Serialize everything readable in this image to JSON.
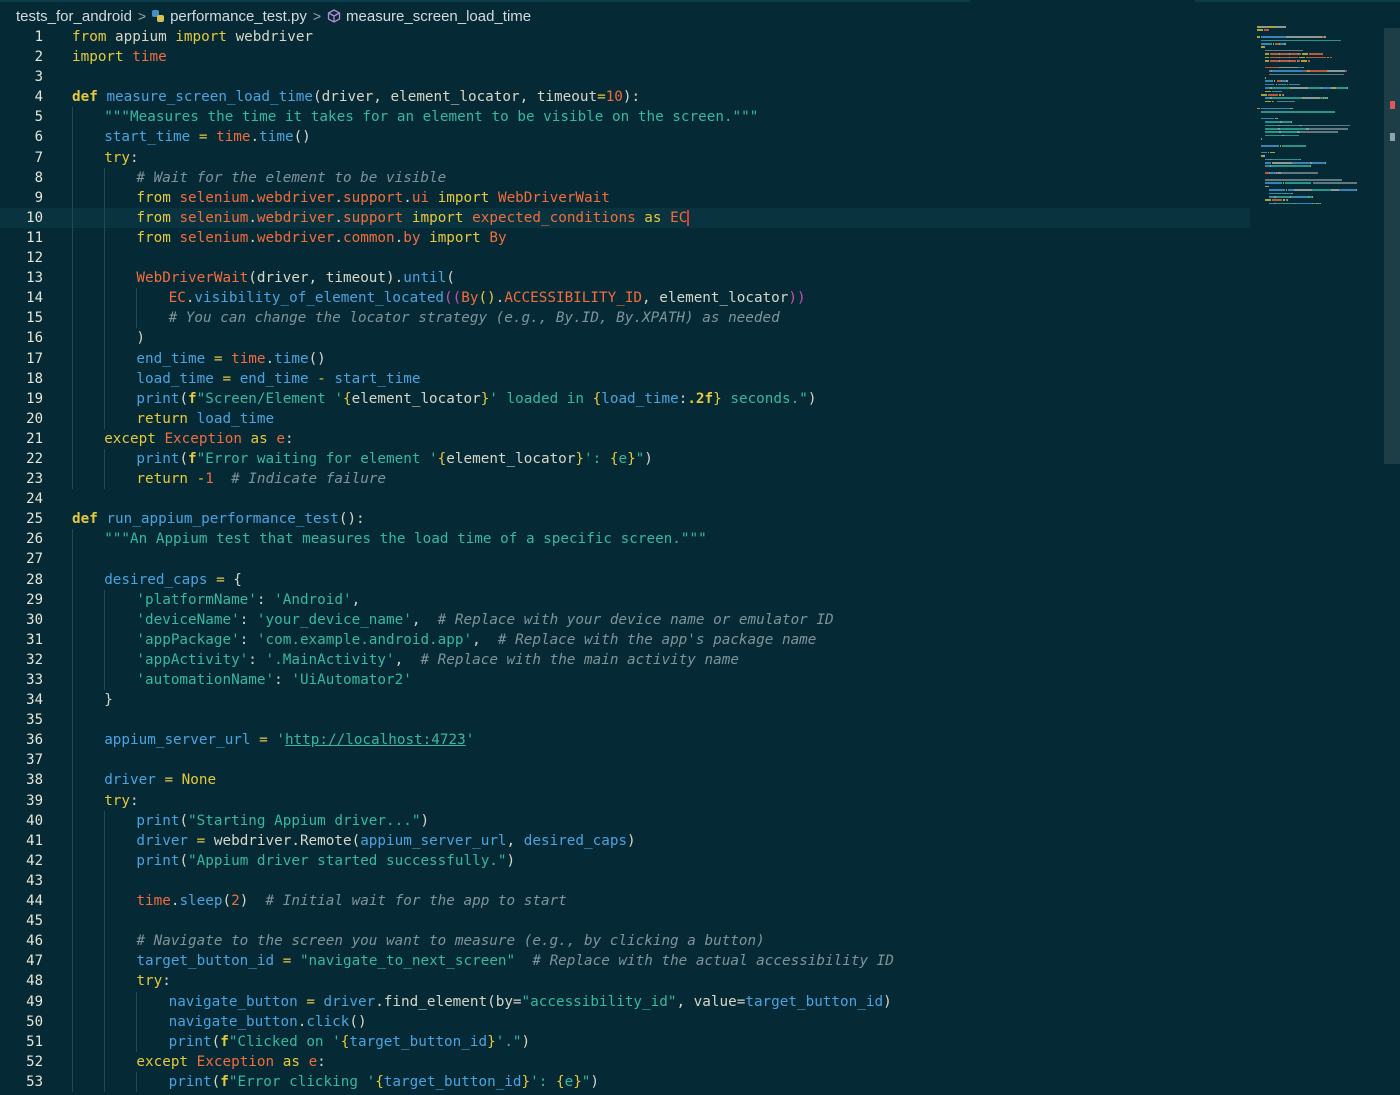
{
  "breadcrumb": {
    "folder": "tests_for_android",
    "file": "performance_test.py",
    "symbol": "measure_screen_load_time",
    "separator": ">"
  },
  "code_lines": [
    {
      "n": "1",
      "indent": 0,
      "segs": [
        [
          "kw",
          "from"
        ],
        [
          "pl",
          " appium "
        ],
        [
          "kw",
          "import"
        ],
        [
          "pl",
          " webdriver"
        ]
      ]
    },
    {
      "n": "2",
      "indent": 0,
      "segs": [
        [
          "kw",
          "import"
        ],
        [
          "pl",
          " "
        ],
        [
          "mod",
          "time"
        ]
      ]
    },
    {
      "n": "3",
      "indent": 0,
      "segs": []
    },
    {
      "n": "4",
      "indent": 0,
      "segs": [
        [
          "kw2",
          "def"
        ],
        [
          "pl",
          " "
        ],
        [
          "fn",
          "measure_screen_load_time"
        ],
        [
          "pl",
          "(driver, element_locator, timeout"
        ],
        [
          "op",
          "="
        ],
        [
          "num",
          "10"
        ],
        [
          "pl",
          "):"
        ]
      ]
    },
    {
      "n": "5",
      "indent": 1,
      "segs": [
        [
          "str",
          "\"\"\"Measures the time it takes for an element to be visible on the screen.\"\"\""
        ]
      ]
    },
    {
      "n": "6",
      "indent": 1,
      "segs": [
        [
          "var",
          "start_time"
        ],
        [
          "pl",
          " "
        ],
        [
          "op",
          "="
        ],
        [
          "pl",
          " "
        ],
        [
          "mod",
          "time"
        ],
        [
          "pl",
          "."
        ],
        [
          "fn",
          "time"
        ],
        [
          "pl",
          "()"
        ]
      ]
    },
    {
      "n": "7",
      "indent": 1,
      "segs": [
        [
          "kw",
          "try"
        ],
        [
          "pl",
          ":"
        ]
      ]
    },
    {
      "n": "8",
      "indent": 2,
      "segs": [
        [
          "cm",
          "# Wait for the element to be visible"
        ]
      ]
    },
    {
      "n": "9",
      "indent": 2,
      "segs": [
        [
          "kw",
          "from"
        ],
        [
          "pl",
          " "
        ],
        [
          "mod",
          "selenium"
        ],
        [
          "pl",
          "."
        ],
        [
          "mod",
          "webdriver"
        ],
        [
          "pl",
          "."
        ],
        [
          "mod",
          "support"
        ],
        [
          "pl",
          "."
        ],
        [
          "mod",
          "ui"
        ],
        [
          "pl",
          " "
        ],
        [
          "kw",
          "import"
        ],
        [
          "pl",
          " "
        ],
        [
          "cls",
          "WebDriverWait"
        ]
      ]
    },
    {
      "n": "10",
      "indent": 2,
      "active": true,
      "segs": [
        [
          "kw",
          "from"
        ],
        [
          "pl",
          " "
        ],
        [
          "mod",
          "selenium"
        ],
        [
          "pl",
          "."
        ],
        [
          "mod",
          "webdriver"
        ],
        [
          "pl",
          "."
        ],
        [
          "mod",
          "support"
        ],
        [
          "pl",
          " "
        ],
        [
          "kw",
          "import"
        ],
        [
          "pl",
          " "
        ],
        [
          "mod",
          "expected_conditions"
        ],
        [
          "pl",
          " "
        ],
        [
          "kw",
          "as"
        ],
        [
          "pl",
          " "
        ],
        [
          "cursor",
          "EC"
        ]
      ]
    },
    {
      "n": "11",
      "indent": 2,
      "segs": [
        [
          "kw",
          "from"
        ],
        [
          "pl",
          " "
        ],
        [
          "mod",
          "selenium"
        ],
        [
          "pl",
          "."
        ],
        [
          "mod",
          "webdriver"
        ],
        [
          "pl",
          "."
        ],
        [
          "mod",
          "common"
        ],
        [
          "pl",
          "."
        ],
        [
          "mod",
          "by"
        ],
        [
          "pl",
          " "
        ],
        [
          "kw",
          "import"
        ],
        [
          "pl",
          " "
        ],
        [
          "cls",
          "By"
        ]
      ]
    },
    {
      "n": "12",
      "indent": 2,
      "segs": []
    },
    {
      "n": "13",
      "indent": 2,
      "segs": [
        [
          "cls",
          "WebDriverWait"
        ],
        [
          "pl",
          "(driver, timeout)."
        ],
        [
          "fn",
          "until"
        ],
        [
          "pl",
          "("
        ]
      ]
    },
    {
      "n": "14",
      "indent": 3,
      "segs": [
        [
          "mod",
          "EC"
        ],
        [
          "pl",
          "."
        ],
        [
          "fn",
          "visibility_of_element_located"
        ],
        [
          "brk2",
          "(("
        ],
        [
          "cls",
          "By"
        ],
        [
          "brk",
          "()"
        ],
        [
          "pl",
          "."
        ],
        [
          "mod",
          "ACCESSIBILITY_ID"
        ],
        [
          "pl",
          ", element_locator"
        ],
        [
          "brk2",
          "))"
        ]
      ]
    },
    {
      "n": "15",
      "indent": 3,
      "segs": [
        [
          "cm",
          "# You can change the locator strategy (e.g., By.ID, By.XPATH) as needed"
        ]
      ]
    },
    {
      "n": "16",
      "indent": 2,
      "segs": [
        [
          "pl",
          ")"
        ]
      ]
    },
    {
      "n": "17",
      "indent": 2,
      "segs": [
        [
          "var",
          "end_time"
        ],
        [
          "pl",
          " "
        ],
        [
          "op",
          "="
        ],
        [
          "pl",
          " "
        ],
        [
          "mod",
          "time"
        ],
        [
          "pl",
          "."
        ],
        [
          "fn",
          "time"
        ],
        [
          "pl",
          "()"
        ]
      ]
    },
    {
      "n": "18",
      "indent": 2,
      "segs": [
        [
          "var",
          "load_time"
        ],
        [
          "pl",
          " "
        ],
        [
          "op",
          "="
        ],
        [
          "pl",
          " "
        ],
        [
          "var",
          "end_time"
        ],
        [
          "pl",
          " "
        ],
        [
          "op",
          "-"
        ],
        [
          "pl",
          " "
        ],
        [
          "var",
          "start_time"
        ]
      ]
    },
    {
      "n": "19",
      "indent": 2,
      "segs": [
        [
          "fn",
          "print"
        ],
        [
          "pl",
          "("
        ],
        [
          "kw2",
          "f"
        ],
        [
          "str",
          "\"Screen/Element '"
        ],
        [
          "brk",
          "{"
        ],
        [
          "pl",
          "element_locator"
        ],
        [
          "brk",
          "}"
        ],
        [
          "str",
          "' loaded in "
        ],
        [
          "brk",
          "{"
        ],
        [
          "var",
          "load_time"
        ],
        [
          "pl",
          ":"
        ],
        [
          "kw2",
          ".2f"
        ],
        [
          "brk",
          "}"
        ],
        [
          "str",
          " seconds.\""
        ],
        [
          "pl",
          ")"
        ]
      ]
    },
    {
      "n": "20",
      "indent": 2,
      "segs": [
        [
          "kw",
          "return"
        ],
        [
          "pl",
          " "
        ],
        [
          "var",
          "load_time"
        ]
      ]
    },
    {
      "n": "21",
      "indent": 1,
      "segs": [
        [
          "kw",
          "except"
        ],
        [
          "pl",
          " "
        ],
        [
          "cls",
          "Exception"
        ],
        [
          "pl",
          " "
        ],
        [
          "kw",
          "as"
        ],
        [
          "pl",
          " "
        ],
        [
          "mod",
          "e"
        ],
        [
          "pl",
          ":"
        ]
      ]
    },
    {
      "n": "22",
      "indent": 2,
      "segs": [
        [
          "fn",
          "print"
        ],
        [
          "pl",
          "("
        ],
        [
          "kw2",
          "f"
        ],
        [
          "str",
          "\"Error waiting for element '"
        ],
        [
          "brk",
          "{"
        ],
        [
          "pl",
          "element_locator"
        ],
        [
          "brk",
          "}"
        ],
        [
          "str",
          "': "
        ],
        [
          "brk",
          "{"
        ],
        [
          "str",
          "e"
        ],
        [
          "brk",
          "}"
        ],
        [
          "str",
          "\""
        ],
        [
          "pl",
          ")"
        ]
      ]
    },
    {
      "n": "23",
      "indent": 2,
      "segs": [
        [
          "kw",
          "return"
        ],
        [
          "pl",
          " "
        ],
        [
          "op",
          "-"
        ],
        [
          "num",
          "1"
        ],
        [
          "pl",
          "  "
        ],
        [
          "cm",
          "# Indicate failure"
        ]
      ]
    },
    {
      "n": "24",
      "indent": 0,
      "segs": []
    },
    {
      "n": "25",
      "indent": 0,
      "segs": [
        [
          "kw2",
          "def"
        ],
        [
          "pl",
          " "
        ],
        [
          "fn",
          "run_appium_performance_test"
        ],
        [
          "pl",
          "():"
        ]
      ]
    },
    {
      "n": "26",
      "indent": 1,
      "segs": [
        [
          "str",
          "\"\"\"An Appium test that measures the load time of a specific screen.\"\"\""
        ]
      ]
    },
    {
      "n": "27",
      "indent": 1,
      "segs": []
    },
    {
      "n": "28",
      "indent": 1,
      "segs": [
        [
          "var",
          "desired_caps"
        ],
        [
          "pl",
          " "
        ],
        [
          "op",
          "="
        ],
        [
          "pl",
          " {"
        ]
      ]
    },
    {
      "n": "29",
      "indent": 2,
      "segs": [
        [
          "str",
          "'platformName'"
        ],
        [
          "pl",
          ": "
        ],
        [
          "str",
          "'Android'"
        ],
        [
          "pl",
          ","
        ]
      ]
    },
    {
      "n": "30",
      "indent": 2,
      "segs": [
        [
          "str",
          "'deviceName'"
        ],
        [
          "pl",
          ": "
        ],
        [
          "str",
          "'your_device_name'"
        ],
        [
          "pl",
          ",  "
        ],
        [
          "cm",
          "# Replace with your device name or emulator ID"
        ]
      ]
    },
    {
      "n": "31",
      "indent": 2,
      "segs": [
        [
          "str",
          "'appPackage'"
        ],
        [
          "pl",
          ": "
        ],
        [
          "str",
          "'com.example.android.app'"
        ],
        [
          "pl",
          ",  "
        ],
        [
          "cm",
          "# Replace with the app's package name"
        ]
      ]
    },
    {
      "n": "32",
      "indent": 2,
      "segs": [
        [
          "str",
          "'appActivity'"
        ],
        [
          "pl",
          ": "
        ],
        [
          "str",
          "'.MainActivity'"
        ],
        [
          "pl",
          ",  "
        ],
        [
          "cm",
          "# Replace with the main activity name"
        ]
      ]
    },
    {
      "n": "33",
      "indent": 2,
      "segs": [
        [
          "str",
          "'automationName'"
        ],
        [
          "pl",
          ": "
        ],
        [
          "str",
          "'UiAutomator2'"
        ]
      ]
    },
    {
      "n": "34",
      "indent": 1,
      "segs": [
        [
          "pl",
          "}"
        ]
      ]
    },
    {
      "n": "35",
      "indent": 1,
      "segs": []
    },
    {
      "n": "36",
      "indent": 1,
      "segs": [
        [
          "var",
          "appium_server_url"
        ],
        [
          "pl",
          " "
        ],
        [
          "op",
          "="
        ],
        [
          "pl",
          " "
        ],
        [
          "str",
          "'"
        ],
        [
          "url",
          "http://localhost:4723"
        ],
        [
          "str",
          "'"
        ]
      ]
    },
    {
      "n": "37",
      "indent": 1,
      "segs": []
    },
    {
      "n": "38",
      "indent": 1,
      "segs": [
        [
          "var",
          "driver"
        ],
        [
          "pl",
          " "
        ],
        [
          "op",
          "="
        ],
        [
          "pl",
          " "
        ],
        [
          "kw",
          "None"
        ]
      ]
    },
    {
      "n": "39",
      "indent": 1,
      "segs": [
        [
          "kw",
          "try"
        ],
        [
          "pl",
          ":"
        ]
      ]
    },
    {
      "n": "40",
      "indent": 2,
      "segs": [
        [
          "fn",
          "print"
        ],
        [
          "pl",
          "("
        ],
        [
          "str",
          "\"Starting Appium driver...\""
        ],
        [
          "pl",
          ")"
        ]
      ]
    },
    {
      "n": "41",
      "indent": 2,
      "segs": [
        [
          "var",
          "driver"
        ],
        [
          "pl",
          " "
        ],
        [
          "op",
          "="
        ],
        [
          "pl",
          " webdriver.Remote("
        ],
        [
          "var",
          "appium_server_url"
        ],
        [
          "pl",
          ", "
        ],
        [
          "var",
          "desired_caps"
        ],
        [
          "pl",
          ")"
        ]
      ]
    },
    {
      "n": "42",
      "indent": 2,
      "segs": [
        [
          "fn",
          "print"
        ],
        [
          "pl",
          "("
        ],
        [
          "str",
          "\"Appium driver started successfully.\""
        ],
        [
          "pl",
          ")"
        ]
      ]
    },
    {
      "n": "43",
      "indent": 2,
      "segs": []
    },
    {
      "n": "44",
      "indent": 2,
      "segs": [
        [
          "mod",
          "time"
        ],
        [
          "pl",
          "."
        ],
        [
          "fn",
          "sleep"
        ],
        [
          "pl",
          "("
        ],
        [
          "num",
          "2"
        ],
        [
          "pl",
          ")  "
        ],
        [
          "cm",
          "# Initial wait for the app to start"
        ]
      ]
    },
    {
      "n": "45",
      "indent": 2,
      "segs": []
    },
    {
      "n": "46",
      "indent": 2,
      "segs": [
        [
          "cm",
          "# Navigate to the screen you want to measure (e.g., by clicking a button)"
        ]
      ]
    },
    {
      "n": "47",
      "indent": 2,
      "segs": [
        [
          "var",
          "target_button_id"
        ],
        [
          "pl",
          " "
        ],
        [
          "op",
          "="
        ],
        [
          "pl",
          " "
        ],
        [
          "str",
          "\"navigate_to_next_screen\""
        ],
        [
          "pl",
          "  "
        ],
        [
          "cm",
          "# Replace with the actual accessibility ID"
        ]
      ]
    },
    {
      "n": "48",
      "indent": 2,
      "segs": [
        [
          "kw",
          "try"
        ],
        [
          "pl",
          ":"
        ]
      ]
    },
    {
      "n": "49",
      "indent": 3,
      "segs": [
        [
          "var",
          "navigate_button"
        ],
        [
          "pl",
          " "
        ],
        [
          "op",
          "="
        ],
        [
          "pl",
          " "
        ],
        [
          "var",
          "driver"
        ],
        [
          "pl",
          ".find_element(by="
        ],
        [
          "str",
          "\"accessibility_id\""
        ],
        [
          "pl",
          ", value="
        ],
        [
          "var",
          "target_button_id"
        ],
        [
          "pl",
          ")"
        ]
      ]
    },
    {
      "n": "50",
      "indent": 3,
      "segs": [
        [
          "var",
          "navigate_button"
        ],
        [
          "pl",
          "."
        ],
        [
          "fn",
          "click"
        ],
        [
          "pl",
          "()"
        ]
      ]
    },
    {
      "n": "51",
      "indent": 3,
      "segs": [
        [
          "fn",
          "print"
        ],
        [
          "pl",
          "("
        ],
        [
          "kw2",
          "f"
        ],
        [
          "str",
          "\"Clicked on '"
        ],
        [
          "brk",
          "{"
        ],
        [
          "var",
          "target_button_id"
        ],
        [
          "brk",
          "}"
        ],
        [
          "str",
          "'.\""
        ],
        [
          "pl",
          ")"
        ]
      ]
    },
    {
      "n": "52",
      "indent": 2,
      "segs": [
        [
          "kw",
          "except"
        ],
        [
          "pl",
          " "
        ],
        [
          "cls",
          "Exception"
        ],
        [
          "pl",
          " "
        ],
        [
          "kw",
          "as"
        ],
        [
          "pl",
          " "
        ],
        [
          "mod",
          "e"
        ],
        [
          "pl",
          ":"
        ]
      ]
    },
    {
      "n": "53",
      "indent": 3,
      "segs": [
        [
          "fn",
          "print"
        ],
        [
          "pl",
          "("
        ],
        [
          "kw2",
          "f"
        ],
        [
          "str",
          "\"Error clicking '"
        ],
        [
          "brk",
          "{"
        ],
        [
          "var",
          "target_button_id"
        ],
        [
          "brk",
          "}"
        ],
        [
          "str",
          "': "
        ],
        [
          "brk",
          "{"
        ],
        [
          "str",
          "e"
        ],
        [
          "brk",
          "}"
        ],
        [
          "str",
          "\""
        ],
        [
          "pl",
          ")"
        ]
      ]
    }
  ],
  "colors": {
    "background": "#052a35",
    "keyword": "#e5c93b",
    "function": "#4aa3e0",
    "string": "#35b8a3",
    "module": "#f26c3d",
    "comment": "#7f949a"
  }
}
